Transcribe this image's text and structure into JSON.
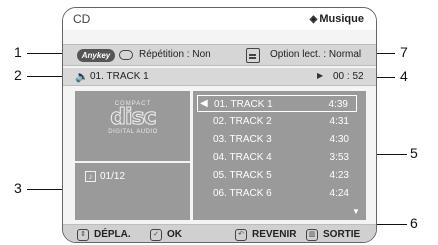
{
  "header": {
    "title": "CD",
    "mode_label": "Musique",
    "mode_icon": "disc-diamond-icon"
  },
  "options": {
    "anykey_label": "Anykey",
    "repeat_text": "Répétition : Non",
    "playback_option_text": "Option lect. : Normal"
  },
  "now_playing": {
    "track": "01. TRACK 1",
    "time": "00 : 52"
  },
  "disc": {
    "logo_top": "COMPACT",
    "logo_word": "disc",
    "logo_bottom": "DIGITAL AUDIO"
  },
  "track_count": "01/12",
  "tracks": [
    {
      "name": "01. TRACK 1",
      "time": "4:39"
    },
    {
      "name": "02. TRACK 2",
      "time": "4:31"
    },
    {
      "name": "03. TRACK 3",
      "time": "4:30"
    },
    {
      "name": "04. TRACK 4",
      "time": "3:53"
    },
    {
      "name": "05. TRACK 5",
      "time": "4:23"
    },
    {
      "name": "06. TRACK 6",
      "time": "4:24"
    }
  ],
  "bottom_bar": {
    "move_label": "DÉPLA.",
    "ok_label": "OK",
    "return_label": "REVENIR",
    "exit_label": "SORTIE"
  },
  "callouts": [
    "1",
    "2",
    "3",
    "4",
    "5",
    "6",
    "7"
  ]
}
